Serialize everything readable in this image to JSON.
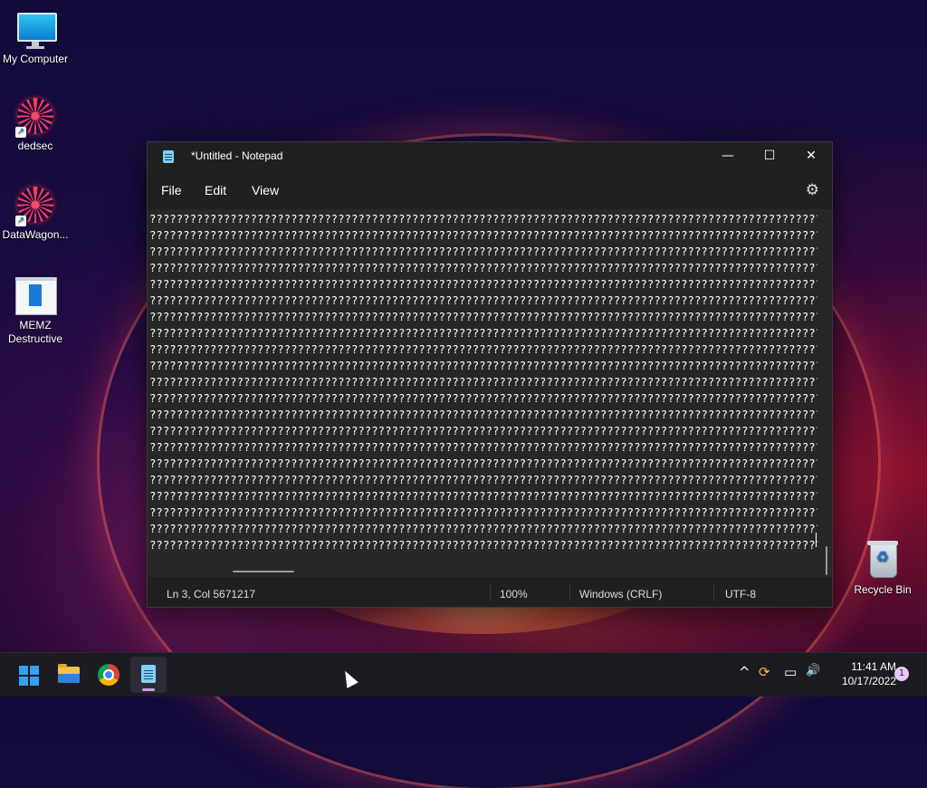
{
  "desktop": {
    "icons": [
      {
        "label": "My Computer",
        "icon": "monitor-icon"
      },
      {
        "label": "dedsec",
        "icon": "mandala-shortcut-icon"
      },
      {
        "label": "DataWagon...",
        "icon": "mandala-shortcut-icon"
      },
      {
        "label": "MEMZ Destructive",
        "icon": "memz-app-icon"
      },
      {
        "label": "Recycle Bin",
        "icon": "recycle-bin-icon"
      }
    ]
  },
  "notepad": {
    "title": "*Untitled - Notepad",
    "menu": [
      "File",
      "Edit",
      "View"
    ],
    "controls": {
      "minimize": "—",
      "maximize": "☐",
      "close": "✕"
    },
    "settings_icon": "gear-icon",
    "line_fill": "??????????????????????????????????????????????????????????????????????????????????????????????????????????????????????????",
    "line_count": 21,
    "status": {
      "position": "Ln 3, Col 5671217",
      "zoom": "100%",
      "line_ending": "Windows (CRLF)",
      "encoding": "UTF-8"
    }
  },
  "taskbar": {
    "apps": [
      "start-icon",
      "file-explorer-icon",
      "chrome-icon",
      "notepad-icon"
    ],
    "tray": {
      "chevron": "^",
      "sync": "⟳",
      "network": "▭",
      "volume": "🔊"
    },
    "time": "11:41 AM",
    "date": "10/17/2022",
    "notification_count": "1"
  },
  "colors": {
    "accent": "#36a0f0",
    "window_bg": "#202020",
    "editor_bg": "#272727"
  }
}
